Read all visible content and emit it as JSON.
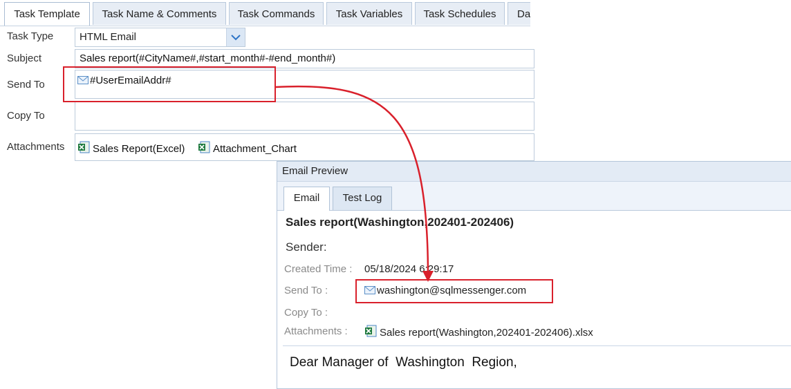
{
  "task_tabs": [
    "Task Template",
    "Task Name & Comments",
    "Task Commands",
    "Task Variables",
    "Task Schedules",
    "Da"
  ],
  "form": {
    "task_type_label": "Task Type",
    "task_type_value": "HTML Email",
    "subject_label": "Subject",
    "subject_value": "Sales report(#CityName#,#start_month#-#end_month#)",
    "send_to_label": "Send To",
    "send_to_value": "#UserEmailAddr#",
    "copy_to_label": "Copy To",
    "attachments_label": "Attachments",
    "attachments": [
      "Sales Report(Excel)",
      "Attachment_Chart"
    ]
  },
  "preview": {
    "title": "Email Preview",
    "tabs": [
      "Email",
      "Test Log"
    ],
    "subject": "Sales report(Washington,202401-202406)",
    "sender_label": "Sender:",
    "created_time_label": "Created Time :",
    "created_time_value": "05/18/2024 6:29:17",
    "send_to_label": "Send To :",
    "send_to_value": "washington@sqlmessenger.com",
    "copy_to_label": "Copy To :",
    "attachments_label": "Attachments :",
    "attachment_file": "Sales report(Washington,202401-202406).xlsx",
    "body_greeting": "Dear Manager of  Washington  Region,"
  },
  "colors": {
    "highlight": "#d9202b",
    "tab_bg": "#e7edf5",
    "panel_header": "#e3ebf5"
  }
}
